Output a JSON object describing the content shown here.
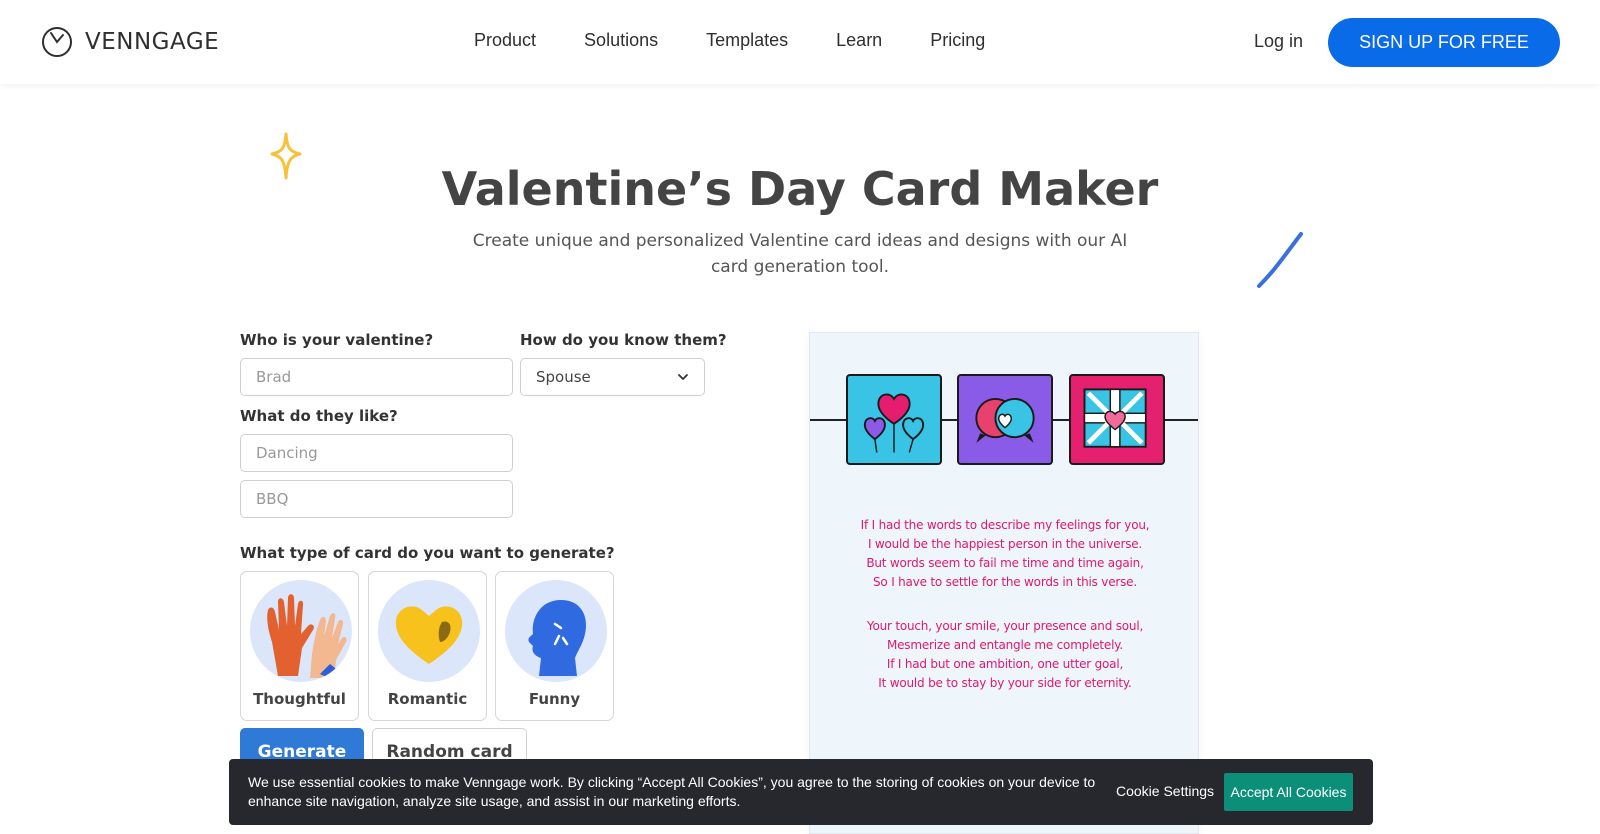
{
  "header": {
    "logo_text": "VENNGAGE",
    "nav": [
      "Product",
      "Solutions",
      "Templates",
      "Learn",
      "Pricing"
    ],
    "login_label": "Log in",
    "signup_label": "SIGN UP FOR FREE",
    "accent_color": "#0a6be8"
  },
  "hero": {
    "title": "Valentine’s Day Card Maker",
    "subtitle": "Create unique and personalized Valentine card ideas and designs with our AI card generation tool."
  },
  "form": {
    "valentine_label": "Who is your valentine?",
    "valentine_placeholder": "Brad",
    "relation_label": "How do you know them?",
    "relation_value": "Spouse",
    "likes_label": "What do they like?",
    "likes_placeholder_1": "Dancing",
    "likes_placeholder_2": "BBQ",
    "card_type_label": "What type of card do you want to generate?",
    "card_types": [
      {
        "label": "Thoughtful",
        "icon": "high-five-icon"
      },
      {
        "label": "Romantic",
        "icon": "gold-heart-icon"
      },
      {
        "label": "Funny",
        "icon": "laughing-head-icon"
      }
    ],
    "generate_label": "Generate",
    "random_label": "Random card"
  },
  "preview": {
    "poem_stanza_1": [
      "If I had the words to describe my feelings for you,",
      "I would be the happiest person in the universe.",
      "But words seem to fail me time and time again,",
      "So I have to settle for the words in this verse."
    ],
    "poem_stanza_2": [
      "Your touch, your smile, your presence and soul,",
      "Mesmerize and entangle me completely.",
      "If I had but one ambition, one utter goal,",
      "It would be to stay by your side for eternity."
    ],
    "poem_color": "#e0186d",
    "tile_icons": [
      "heart-balloons-icon",
      "speech-bubbles-icon",
      "gift-box-icon"
    ]
  },
  "cookie": {
    "text": "We use essential cookies to make Venngage work. By clicking “Accept All Cookies”, you agree to the storing of cookies on your device to enhance site navigation, analyze site usage, and assist in our marketing efforts.",
    "settings_label": "Cookie Settings",
    "accept_label": "Accept All Cookies"
  }
}
